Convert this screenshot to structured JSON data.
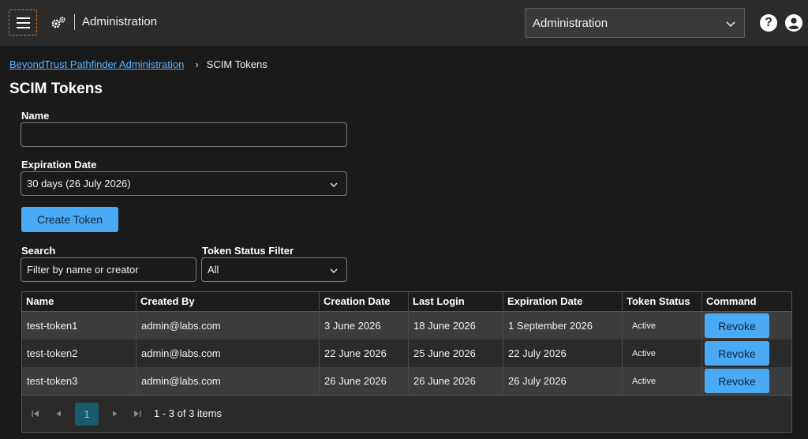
{
  "header": {
    "app_title": "Administration",
    "workspace_selected": "Administration",
    "help_label": "?"
  },
  "breadcrumb": {
    "root": "BeyondTrust Pathfinder Administration",
    "separator": "›",
    "current": "SCIM Tokens"
  },
  "page": {
    "title": "SCIM Tokens"
  },
  "form": {
    "name_label": "Name",
    "name_value": "",
    "expiration_label": "Expiration Date",
    "expiration_value": "30 days (26 July 2026)",
    "create_button": "Create Token"
  },
  "filters": {
    "search_label": "Search",
    "search_placeholder": "Filter by name or creator",
    "status_label": "Token Status Filter",
    "status_value": "All"
  },
  "table": {
    "columns": [
      "Name",
      "Created By",
      "Creation Date",
      "Last Login",
      "Expiration Date",
      "Token Status",
      "Command"
    ],
    "rows": [
      {
        "name": "test-token1",
        "created_by": "admin@labs.com",
        "creation_date": "3 June 2026",
        "last_login": "18 June 2026",
        "expiration_date": "1 September 2026",
        "status": "Active",
        "command": "Revoke"
      },
      {
        "name": "test-token2",
        "created_by": "admin@labs.com",
        "creation_date": "22 June 2026",
        "last_login": "25 June 2026",
        "expiration_date": "22 July 2026",
        "status": "Active",
        "command": "Revoke"
      },
      {
        "name": "test-token3",
        "created_by": "admin@labs.com",
        "creation_date": "26 June 2026",
        "last_login": "26 June 2026",
        "expiration_date": "26 July 2026",
        "status": "Active",
        "command": "Revoke"
      }
    ]
  },
  "pager": {
    "current_page": "1",
    "info": "1 - 3 of 3 items"
  },
  "colors": {
    "accent": "#4aaaf5",
    "link": "#5db3ff",
    "topbar": "#2b2b2b",
    "background": "#1a1a1a"
  }
}
